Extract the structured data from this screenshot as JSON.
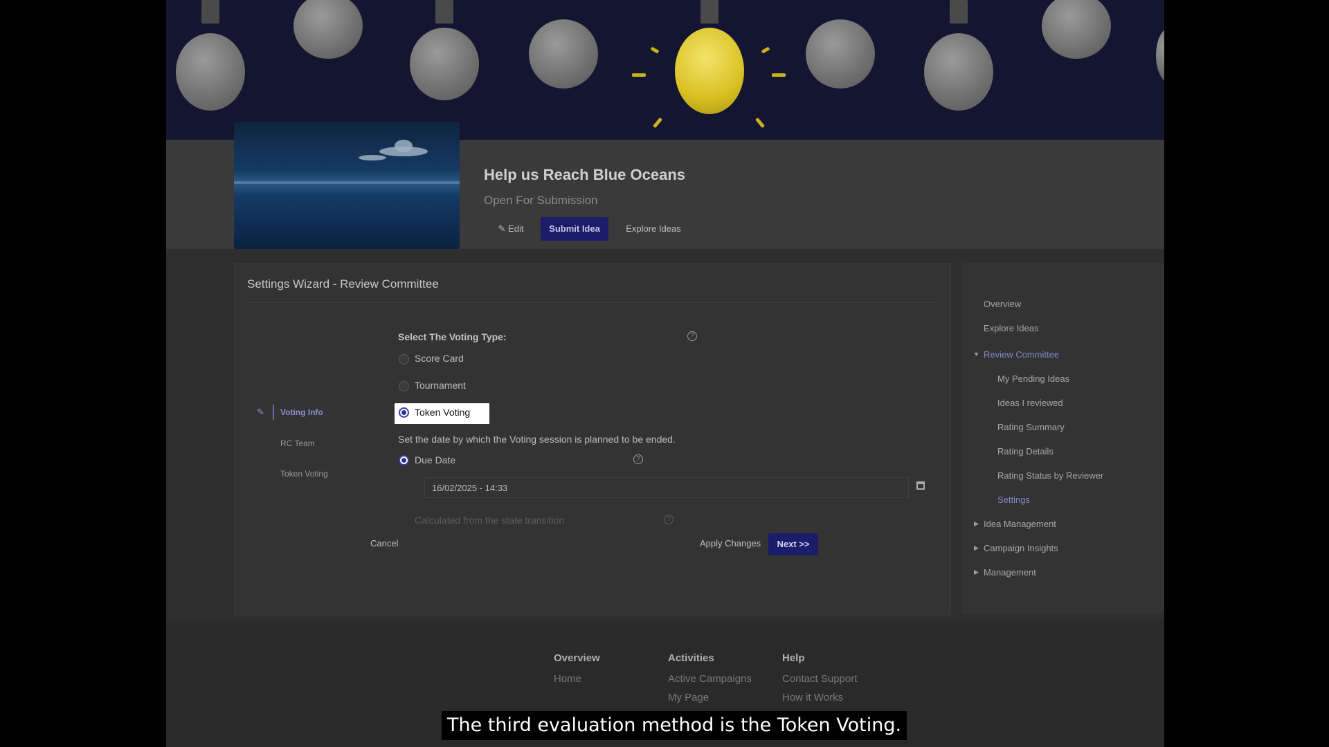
{
  "campaign": {
    "title": "Help us Reach Blue Oceans",
    "status": "Open For Submission",
    "edit_label": "Edit",
    "submit_label": "Submit Idea",
    "explore_label": "Explore Ideas"
  },
  "wizard": {
    "title": "Settings Wizard - Review Committee",
    "steps": [
      "Voting Info",
      "RC Team",
      "Token Voting"
    ],
    "voting_type_label": "Select The Voting Type:",
    "options": [
      "Score Card",
      "Tournament",
      "Token Voting"
    ],
    "selected_option": "Token Voting",
    "date_instruction": "Set the date by which the Voting session is planned to be ended.",
    "due_date_label": "Due Date",
    "due_date_value": "16/02/2025 - 14:33",
    "calculated_label": "Calculated from the state transition",
    "cancel_label": "Cancel",
    "apply_label": "Apply Changes",
    "next_label": "Next >>"
  },
  "sidenav": {
    "overview": "Overview",
    "explore": "Explore Ideas",
    "review_committee": "Review Committee",
    "sub": [
      "My Pending Ideas",
      "Ideas I reviewed",
      "Rating Summary",
      "Rating Details",
      "Rating Status by Reviewer",
      "Settings"
    ],
    "idea_management": "Idea Management",
    "campaign_insights": "Campaign Insights",
    "management": "Management"
  },
  "footer": {
    "columns": [
      {
        "heading": "Overview",
        "links": [
          "Home"
        ]
      },
      {
        "heading": "Activities",
        "links": [
          "Active Campaigns",
          "My Page"
        ]
      },
      {
        "heading": "Help",
        "links": [
          "Contact Support",
          "How it Works"
        ]
      }
    ]
  },
  "subtitle": "The third evaluation method is the Token Voting.",
  "colors": {
    "accent": "#1b1c6a",
    "highlight": "#ffffff",
    "overlay": "#000000"
  }
}
